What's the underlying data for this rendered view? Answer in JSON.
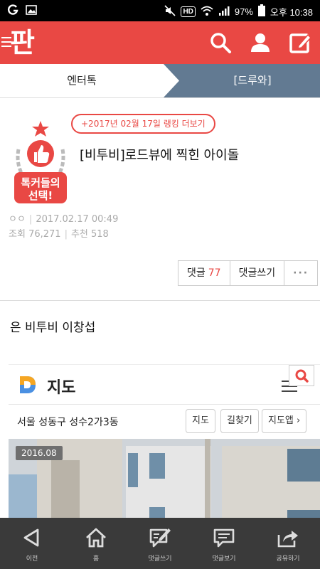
{
  "status_bar": {
    "battery": "97%",
    "time": "오후 10:38",
    "hd_label": "HD",
    "icons": [
      "app-notification-icon",
      "image-icon",
      "mute-icon",
      "hd-icon",
      "wifi-icon",
      "signal-icon",
      "battery-icon"
    ]
  },
  "header": {
    "logo": "판",
    "icons": [
      "menu-icon",
      "search-icon",
      "user-icon",
      "write-icon"
    ]
  },
  "tabs": {
    "left": "엔터톡",
    "right": "[드루와]"
  },
  "post": {
    "badge_text_line1": "톡커들의",
    "badge_text_line2": "선택!",
    "ranking_link": "+2017년 02월 17일 랭킹 더보기",
    "title": "[비투비]로드뷰에 찍힌 아이돌",
    "author": "ㅇㅇ",
    "datetime": "2017.02.17 00:49",
    "views_label": "조회",
    "views": "76,271",
    "recommend_label": "추천",
    "recommend": "518",
    "comment_label": "댓글",
    "comment_count": "77",
    "write_comment_label": "댓글쓰기",
    "more_label": "···",
    "body_text": "은 비투비 이창섭"
  },
  "embed": {
    "title": "지도",
    "address": "서울 성동구 성수2가3동",
    "chips": [
      "지도",
      "길찾기",
      "지도앱 ›"
    ],
    "date_tag": "2016.08"
  },
  "bottom_nav": [
    {
      "label": "이전",
      "icon": "back-icon"
    },
    {
      "label": "홈",
      "icon": "home-icon"
    },
    {
      "label": "댓글쓰기",
      "icon": "write-comment-icon"
    },
    {
      "label": "댓글보기",
      "icon": "view-comments-icon"
    },
    {
      "label": "공유하기",
      "icon": "share-icon"
    }
  ],
  "colors": {
    "brand_red": "#e94844",
    "tab_active": "#627a92",
    "bottom_nav": "#3a3a3a"
  }
}
